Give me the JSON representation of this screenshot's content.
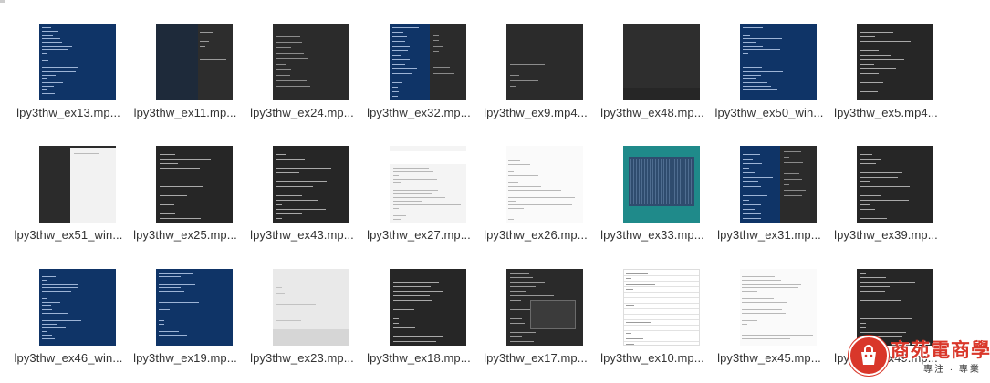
{
  "files": [
    {
      "name": "lpy3thw_ex13.mp...",
      "theme": "blue-terminal"
    },
    {
      "name": "lpy3thw_ex11.mp...",
      "theme": "split-dark"
    },
    {
      "name": "lpy3thw_ex24.mp...",
      "theme": "dark-editor"
    },
    {
      "name": "lpy3thw_ex32.mp...",
      "theme": "blue-split"
    },
    {
      "name": "lpy3thw_ex9.mp4...",
      "theme": "dark-editor"
    },
    {
      "name": "lpy3thw_ex48.mp...",
      "theme": "dark-plain"
    },
    {
      "name": "lpy3thw_ex50_win...",
      "theme": "blue-terminal"
    },
    {
      "name": "lpy3thw_ex5.mp4...",
      "theme": "dark-code"
    },
    {
      "name": "lpy3thw_ex51_win...",
      "theme": "dark-white-window"
    },
    {
      "name": "lpy3thw_ex25.mp...",
      "theme": "dark-code"
    },
    {
      "name": "lpy3thw_ex43.mp...",
      "theme": "dark-code"
    },
    {
      "name": "lpy3thw_ex27.mp...",
      "theme": "web-doc"
    },
    {
      "name": "lpy3thw_ex26.mp...",
      "theme": "light-doc"
    },
    {
      "name": "lpy3thw_ex33.mp...",
      "theme": "teal-window"
    },
    {
      "name": "lpy3thw_ex31.mp...",
      "theme": "blue-split"
    },
    {
      "name": "lpy3thw_ex39.mp...",
      "theme": "dark-code"
    },
    {
      "name": "lpy3thw_ex46_win...",
      "theme": "blue-terminal"
    },
    {
      "name": "lpy3thw_ex19.mp...",
      "theme": "blue-terminal"
    },
    {
      "name": "lpy3thw_ex23.mp...",
      "theme": "light-gray"
    },
    {
      "name": "lpy3thw_ex18.mp...",
      "theme": "dark-code"
    },
    {
      "name": "lpy3thw_ex17.mp...",
      "theme": "dark-dialog"
    },
    {
      "name": "lpy3thw_ex10.mp...",
      "theme": "light-table"
    },
    {
      "name": "lpy3thw_ex45.mp...",
      "theme": "light-doc"
    },
    {
      "name": "lpy3thw_ex49.mp...",
      "theme": "dark-code"
    }
  ],
  "logo": {
    "brand": "商苑電商學院",
    "slogan": "專注 · 專業",
    "icon": "shopping-bag-icon",
    "color": "#d9372a"
  },
  "colors": {
    "blue_terminal": "#0f3467",
    "dark_editor": "#2b2b2b",
    "teal": "#1f8a8a",
    "label_text": "#333333"
  }
}
